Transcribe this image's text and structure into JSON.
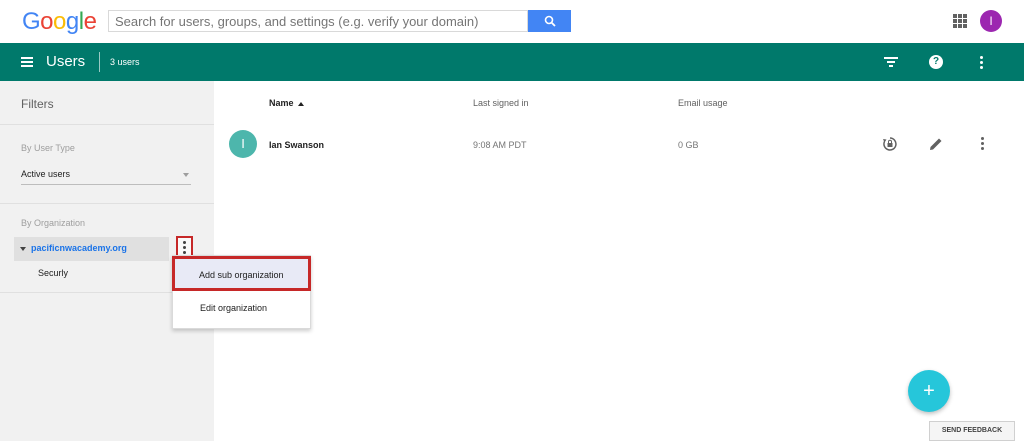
{
  "topbar": {
    "logo": [
      "G",
      "o",
      "o",
      "g",
      "l",
      "e"
    ],
    "logo_colors": [
      "#4285f4",
      "#ea4335",
      "#fbbc05",
      "#4285f4",
      "#34a853",
      "#ea4335"
    ],
    "search_placeholder": "Search for users, groups, and settings (e.g. verify your domain)",
    "account_initial": "I"
  },
  "header": {
    "title": "Users",
    "count": "3 users"
  },
  "sidebar": {
    "title": "Filters",
    "user_type_label": "By User Type",
    "user_type_value": "Active users",
    "org_label": "By Organization",
    "org_root": "pacificnwacademy.org",
    "org_child": "Securly"
  },
  "context_menu": {
    "add_label": "Add sub organization",
    "edit_label": "Edit organization"
  },
  "table": {
    "columns": [
      "Name",
      "Last signed in",
      "Email usage"
    ],
    "rows": [
      {
        "initial": "I",
        "name": "Ian Swanson",
        "last_signed_in": "9:08 AM PDT",
        "email_usage": "0 GB"
      }
    ]
  },
  "fab_label": "+",
  "feedback_label": "SEND FEEDBACK",
  "colors": {
    "header_bg": "#00796b",
    "accent_blue": "#4285f4",
    "fab": "#26c6da",
    "highlight_red": "#c62828"
  }
}
